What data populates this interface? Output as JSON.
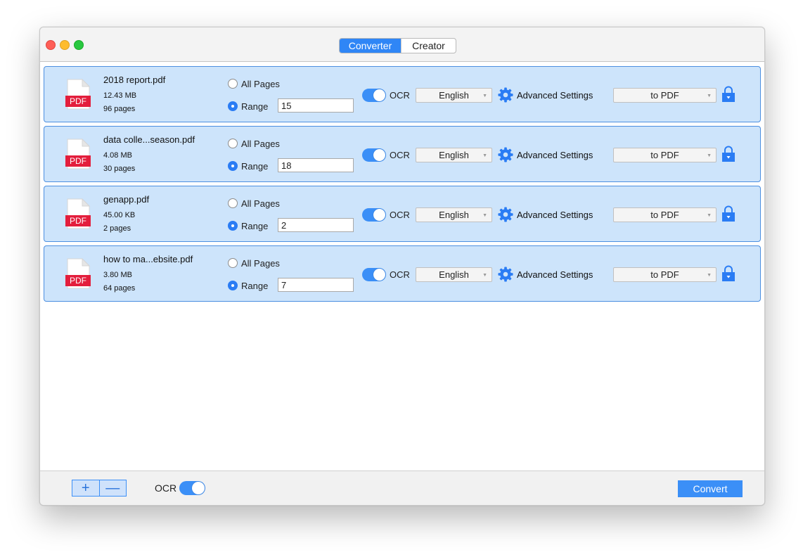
{
  "tabs": {
    "converter": "Converter",
    "creator": "Creator"
  },
  "labels": {
    "all_pages": "All Pages",
    "range": "Range",
    "ocr": "OCR",
    "advanced": "Advanced Settings",
    "pdf_badge": "PDF",
    "lang_caret": "▼",
    "fmt_caret": "▼"
  },
  "files": [
    {
      "name": "2018 report.pdf",
      "size": "12.43 MB",
      "pages": "96 pages",
      "range": "15",
      "language": "English",
      "format": "to PDF",
      "range_selected": true,
      "ocr_on": true
    },
    {
      "name": "data colle...season.pdf",
      "size": "4.08 MB",
      "pages": "30 pages",
      "range": "18",
      "language": "English",
      "format": "to PDF",
      "range_selected": true,
      "ocr_on": true
    },
    {
      "name": "genapp.pdf",
      "size": "45.00 KB",
      "pages": "2 pages",
      "range": "2",
      "language": "English",
      "format": "to PDF",
      "range_selected": true,
      "ocr_on": true
    },
    {
      "name": "how to ma...ebsite.pdf",
      "size": "3.80 MB",
      "pages": "64 pages",
      "range": "7",
      "language": "English",
      "format": "to PDF",
      "range_selected": true,
      "ocr_on": true
    }
  ],
  "bottom": {
    "add": "+",
    "remove": "—",
    "ocr": "OCR",
    "ocr_on": true,
    "convert": "Convert"
  },
  "colors": {
    "accent": "#3b8ff7",
    "row_bg": "#cde4fb",
    "row_border": "#4c8fe0",
    "pdf_red": "#e31e3c"
  }
}
